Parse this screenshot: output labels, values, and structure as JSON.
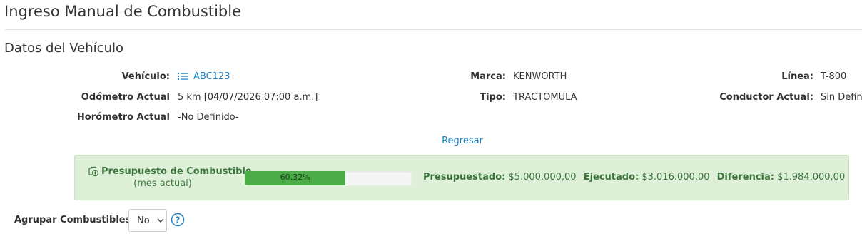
{
  "page": {
    "title": "Ingreso Manual de Combustible",
    "section_title": "Datos del Vehículo",
    "back_link": "Regresar"
  },
  "vehicle": {
    "vehicle_label": "Vehículo:",
    "vehicle_icon": "list-icon",
    "vehicle_value": "ABC123",
    "odometer_label": "Odómetro Actual",
    "odometer_value": "5 km [04/07/2026 07:00 a.m.]",
    "hourmeter_label": "Horómetro Actual",
    "hourmeter_value": "-No Definido-",
    "brand_label": "Marca:",
    "brand_value": "KENWORTH",
    "type_label": "Tipo:",
    "type_value": "TRACTOMULA",
    "line_label": "Línea:",
    "line_value": "T-800",
    "driver_label": "Conductor Actual:",
    "driver_value": "Sin Defin"
  },
  "budget": {
    "icon": "budget-icon",
    "title": "Presupuesto de Combustible",
    "subtitle": "(mes actual)",
    "progress_percent": 60.32,
    "progress_label": "60.32%",
    "budgeted_label": "Presupuestado:",
    "budgeted_value": "$5.000.000,00",
    "executed_label": "Ejecutado:",
    "executed_value": "$3.016.000,00",
    "difference_label": "Diferencia:",
    "difference_value": "$1.984.000,00"
  },
  "grouping": {
    "label": "Agrupar Combustibles",
    "selected": "No",
    "help_icon": "question-circle-icon"
  },
  "colors": {
    "link": "#1a82c4",
    "success_text": "#3c763d",
    "success_bg": "#dff0d8",
    "progress_fill": "#4cad48"
  }
}
